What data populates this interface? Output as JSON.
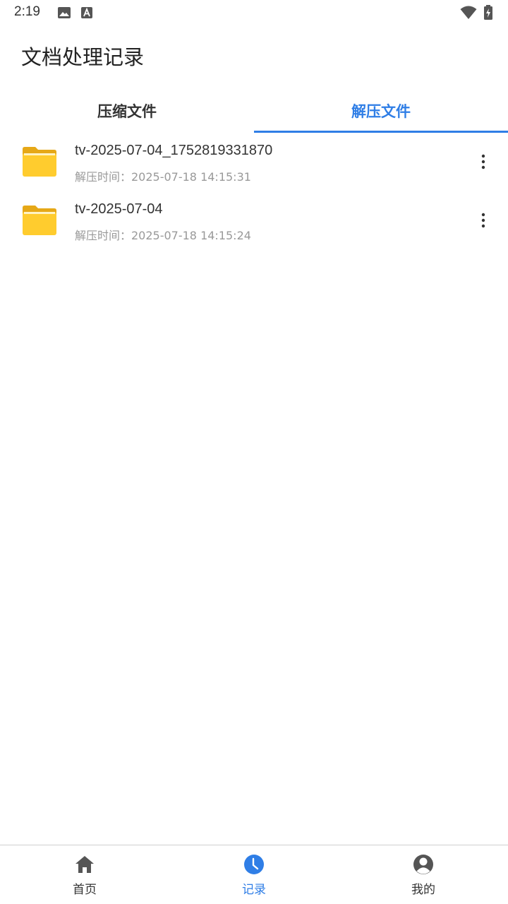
{
  "status_bar": {
    "time": "2:19",
    "icons": [
      "image-icon",
      "text-a-icon",
      "wifi-icon",
      "battery-charging-icon"
    ]
  },
  "header": {
    "title": "文档处理记录"
  },
  "tabs": [
    {
      "label": "压缩文件",
      "active": false
    },
    {
      "label": "解压文件",
      "active": true
    }
  ],
  "files": [
    {
      "name": "tv-2025-07-04_1752819331870",
      "time": "解压时间：2025-07-18 14:15:31",
      "icon": "folder-icon"
    },
    {
      "name": "tv-2025-07-04",
      "time": "解压时间：2025-07-18 14:15:24",
      "icon": "folder-icon"
    }
  ],
  "bottom_nav": [
    {
      "label": "首页",
      "icon": "home-icon",
      "active": false
    },
    {
      "label": "记录",
      "icon": "clock-icon",
      "active": true
    },
    {
      "label": "我的",
      "icon": "user-icon",
      "active": false
    }
  ],
  "colors": {
    "accent": "#2f7ee6",
    "folder": "#ffcc33",
    "folder_tab": "#e8a817"
  }
}
